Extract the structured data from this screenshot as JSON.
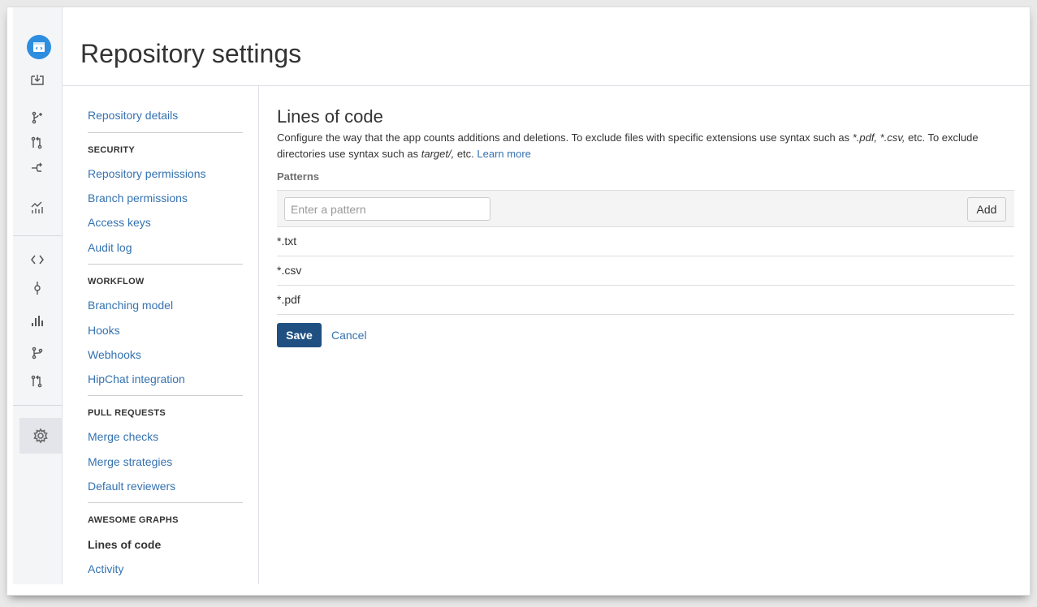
{
  "page": {
    "title": "Repository settings"
  },
  "sidebar_icons": [
    "repository-logo-icon",
    "clone-icon",
    "create-branch-icon",
    "create-pull-request-icon",
    "fork-icon",
    "graphs-icon",
    "source-icon",
    "commits-icon",
    "awesome-graphs-icon",
    "branches-icon",
    "pull-requests-icon",
    "settings-icon"
  ],
  "nav": {
    "repo_details": "Repository details",
    "security": {
      "heading": "SECURITY",
      "items": [
        "Repository permissions",
        "Branch permissions",
        "Access keys",
        "Audit log"
      ]
    },
    "workflow": {
      "heading": "WORKFLOW",
      "items": [
        "Branching model",
        "Hooks",
        "Webhooks",
        "HipChat integration"
      ]
    },
    "pull_requests": {
      "heading": "PULL REQUESTS",
      "items": [
        "Merge checks",
        "Merge strategies",
        "Default reviewers"
      ]
    },
    "awesome_graphs": {
      "heading": "AWESOME GRAPHS",
      "items": [
        "Lines of code",
        "Activity"
      ]
    }
  },
  "main": {
    "heading": "Lines of code",
    "desc_1": "Configure the way that the app counts additions and deletions. To exclude files with specific extensions use syntax such as ",
    "desc_ex1": "*.pdf,",
    "desc_ex2": "*.csv,",
    "desc_2": " etc. To exclude directories use syntax such as ",
    "desc_ex3": "target/,",
    "desc_3": " etc. ",
    "learn_more": "Learn more",
    "patterns_label": "Patterns",
    "input_placeholder": "Enter a pattern",
    "add_label": "Add",
    "patterns": [
      "*.txt",
      "*.csv",
      "*.pdf"
    ],
    "save_label": "Save",
    "cancel_label": "Cancel"
  },
  "colors": {
    "link": "#3572b0",
    "primary_button": "#205081",
    "logo": "#2d8ee0"
  }
}
